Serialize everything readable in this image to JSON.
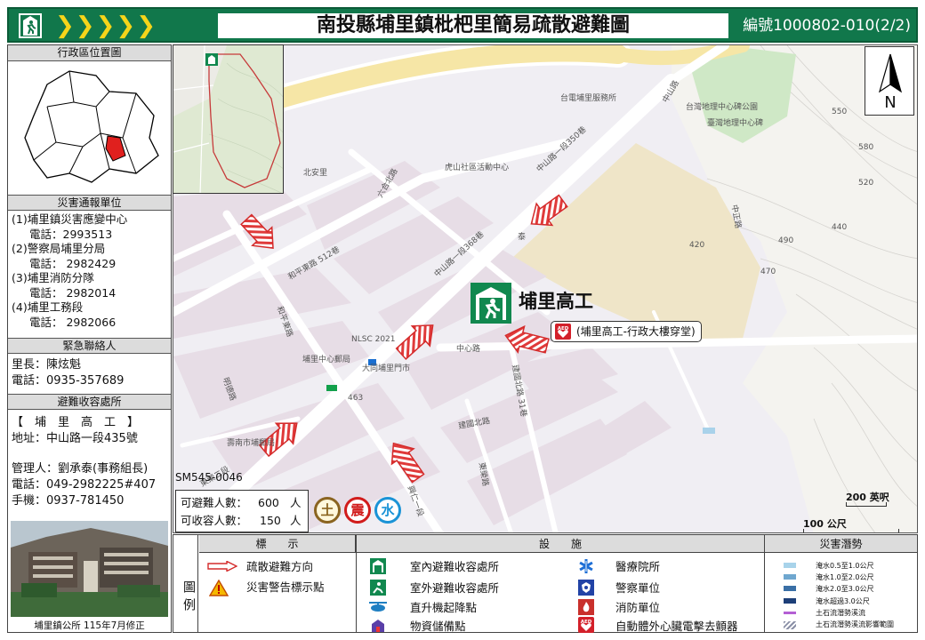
{
  "header": {
    "title": "南投縣埔里鎮枇杷里簡易疏散避難圖",
    "code": "編號1000802-010(2/2)"
  },
  "left_panel": {
    "admin_map_title": "行政區位置圖",
    "disaster_units_title": "災害通報單位",
    "units": [
      {
        "name": "(1)埔里鎮災害應變中心",
        "phone": "電話：2993513"
      },
      {
        "name": "(2)警察局埔里分局",
        "phone": "電話： 2982429"
      },
      {
        "name": "(3)埔里消防分隊",
        "phone": "電話： 2982014"
      },
      {
        "name": "(4)埔里工務段",
        "phone": "電話： 2982066"
      }
    ],
    "emergency_title": "緊急聯絡人",
    "chief": "里長：陳炫魁",
    "chief_phone": "電話：0935-357689",
    "shelter_title": "避難收容處所",
    "shelter_name": "【　埔　里　高　工　】",
    "shelter_address": "地址：中山路一段435號",
    "manager": "管理人：劉承泰(事務組長)",
    "manager_phone": "電話：049-2982225#407",
    "manager_mobile": "手機：0937-781450",
    "photo_caption": "埔里鎮公所 115年7月修正"
  },
  "map": {
    "sheet_id": "SM545-0046",
    "shelter_label": "埔里高工",
    "aed_label": "(埔里高工-行政大樓穿堂)",
    "capacity": {
      "evac_label": "可避難人數：",
      "evac_value": "600",
      "house_label": "可收容人數：",
      "house_value": "150",
      "unit": "人"
    },
    "hazard_badges": [
      "土",
      "震",
      "水"
    ],
    "hazard_colors": [
      "#8a6420",
      "#d11b1b",
      "#1a93d6"
    ],
    "scale_ft": "200 英呎",
    "scale_m": "100 公尺",
    "compass_letter": "N",
    "street_labels": [
      "台電埔里服務所",
      "台灣地理中心碑公園",
      "臺灣地理中心碑",
      "虎山社區活動中心",
      "北安里",
      "六合北路",
      "和平東路 512巷",
      "中山路一段368巷",
      "中山路一段350巷",
      "中山路",
      "中心路",
      "建國北路 31巷",
      "建國北路",
      "東榮路",
      "埔里中心郵局",
      "大同埔里門市",
      "壽南市埔郵局",
      "東榮二段",
      "和平東路",
      "明德路",
      "興仁一段",
      "中正路",
      "泰",
      "440",
      "470",
      "490",
      "520",
      "550",
      "580",
      "420",
      "NLSC 2021",
      "463"
    ]
  },
  "legend": {
    "side_label": "圖例",
    "col_markers": "標　　示",
    "col_facilities": "設　　施",
    "col_hazards": "災害潛勢",
    "markers": [
      "疏散避難方向",
      "災害警告標示點"
    ],
    "facilities_left": [
      "室內避難收容處所",
      "室外避難收容處所",
      "直升機起降點",
      "物資儲備點"
    ],
    "facilities_right": [
      "醫療院所",
      "警察單位",
      "消防單位",
      "自動體外心臟電擊去顫器"
    ],
    "hazards": [
      {
        "label": "淹水0.5至1.0公尺",
        "color": "#a8d3ea"
      },
      {
        "label": "淹水1.0至2.0公尺",
        "color": "#6fa7cf"
      },
      {
        "label": "淹水2.0至3.0公尺",
        "color": "#3a6fa6"
      },
      {
        "label": "淹水超過3.0公尺",
        "color": "#1d3f78"
      },
      {
        "label": "土石流潛勢溪流",
        "color": "#b45fd4"
      },
      {
        "label": "土石流潛勢溪流影響範圍",
        "color": "#8a8fa6"
      }
    ]
  },
  "colors": {
    "header_green": "#11774b",
    "accent_yellow": "#f5d51a",
    "arrow_red": "#e03a3a"
  }
}
